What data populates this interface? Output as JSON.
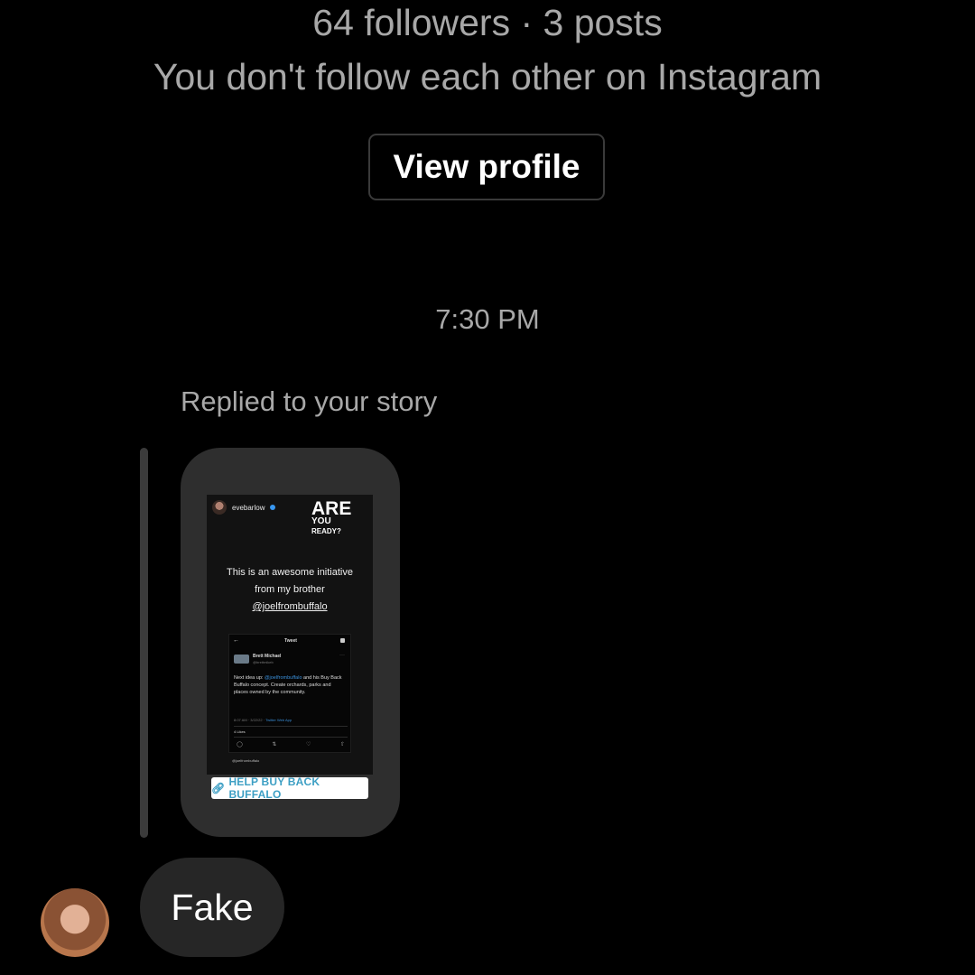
{
  "profile": {
    "stats": "64 followers · 3 posts",
    "follow_status": "You don't follow each other on Instagram",
    "view_profile_label": "View profile"
  },
  "thread": {
    "timestamp": "7:30 PM",
    "reply_context": "Replied to your story"
  },
  "story": {
    "username": "evebarlow",
    "headline_big": "ARE",
    "headline_you": "YOU",
    "headline_ready": "READY?",
    "caption_line1": "This is an awesome initiative",
    "caption_line2": "from my brother",
    "caption_mention": "@joelfrombuffalo",
    "tweet": {
      "header": "Tweet",
      "author": "Brett Michael",
      "handle": "@brettmikeb",
      "body_prefix": "Next idea up: ",
      "body_mention": "@joelfrombuffalo",
      "body_rest": " and his Buy Back Buffalo concept. Create orchards, parks and places owned by the community.",
      "meta_time": "8:07 AM · 3/22/22 · ",
      "meta_source": "Twitter Web App",
      "likes": "4 Likes"
    },
    "credit": "@joelfrombuffalo",
    "link_sticker": "HELP BUY BACK BUFFALO"
  },
  "message": {
    "text": "Fake"
  },
  "icons": {
    "back": "arrow-left-icon",
    "link": "link-icon",
    "reply": "reply-icon",
    "retweet": "retweet-icon",
    "like": "heart-icon",
    "share": "share-icon"
  },
  "colors": {
    "background": "#000000",
    "secondary_text": "#a8a8a8",
    "bubble": "#262626",
    "story_card": "#2e2e2e",
    "link_blue": "#3d9fc4",
    "verified": "#3897f0"
  }
}
